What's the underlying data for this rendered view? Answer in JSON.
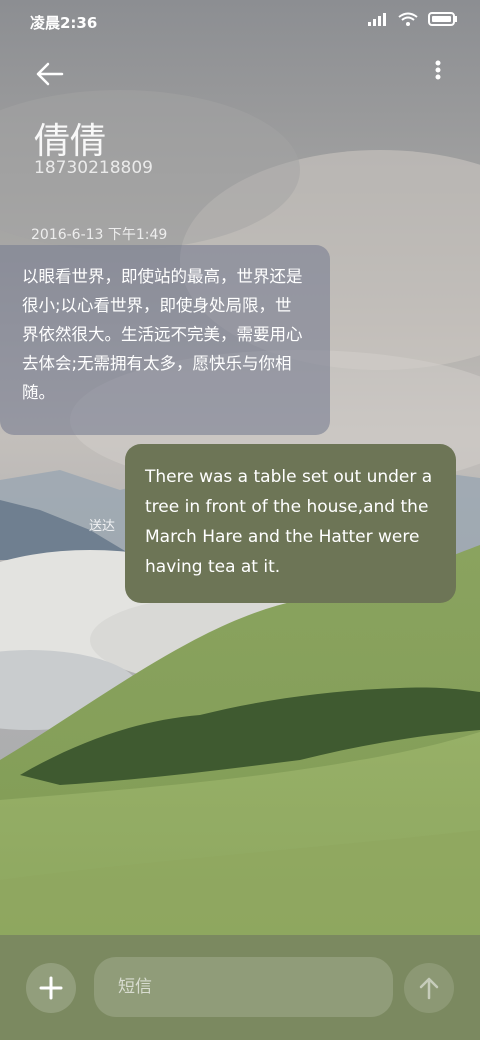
{
  "status_bar": {
    "time": "凌晨2:36"
  },
  "contact": {
    "name": "倩倩",
    "phone": "18730218809"
  },
  "conversation": {
    "timestamp": "2016-6-13 下午1:49",
    "incoming_message": "以眼看世界，即使站的最高，世界还是很小;以心看世界，即使身处局限，世界依然很大。生活远不完美，需要用心去体会;无需拥有太多，愿快乐与你相随。",
    "outgoing_message": "There was a table set out under a tree in front of the house,and the March Hare and the Hatter were having tea at it.",
    "delivery_status": "送达"
  },
  "composer": {
    "placeholder": "短信"
  },
  "colors": {
    "outgoing_bubble": "#6d7556",
    "composer_bar": "#78845f"
  },
  "icons": [
    "signal-icon",
    "wifi-icon",
    "battery-icon",
    "back-arrow-icon",
    "more-vertical-icon",
    "plus-icon",
    "send-arrow-icon"
  ]
}
